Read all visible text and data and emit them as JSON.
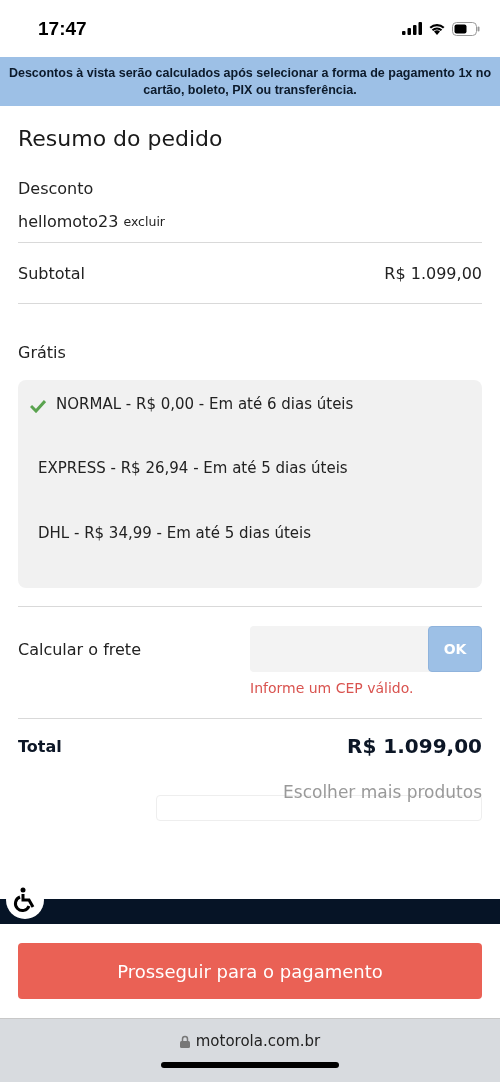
{
  "status_bar": {
    "time": "17:47"
  },
  "banner": {
    "text": "Descontos à vista serão calculados após selecionar a forma de pagamento 1x no cartão, boleto, PIX ou transferência."
  },
  "title": "Resumo do pedido",
  "discount": {
    "label": "Desconto",
    "code": "hellomoto23",
    "remove": "excluir"
  },
  "subtotal": {
    "label": "Subtotal",
    "value": "R$ 1.099,00"
  },
  "shipping": {
    "label": "Grátis",
    "options": [
      {
        "label": "NORMAL - R$ 0,00 - Em até 6 dias úteis",
        "selected": true
      },
      {
        "label": "EXPRESS - R$ 26,94 - Em até 5 dias úteis",
        "selected": false
      },
      {
        "label": "DHL - R$ 34,99 - Em até 5 dias úteis",
        "selected": false
      }
    ]
  },
  "freight": {
    "label": "Calcular o frete",
    "button": "OK",
    "error": "Informe um CEP válido."
  },
  "total": {
    "label": "Total",
    "value": "R$ 1.099,00"
  },
  "more_products": "Escolher mais produtos",
  "checkout_button": "Prosseguir para o pagamento",
  "browser": {
    "url": "motorola.com.br"
  }
}
